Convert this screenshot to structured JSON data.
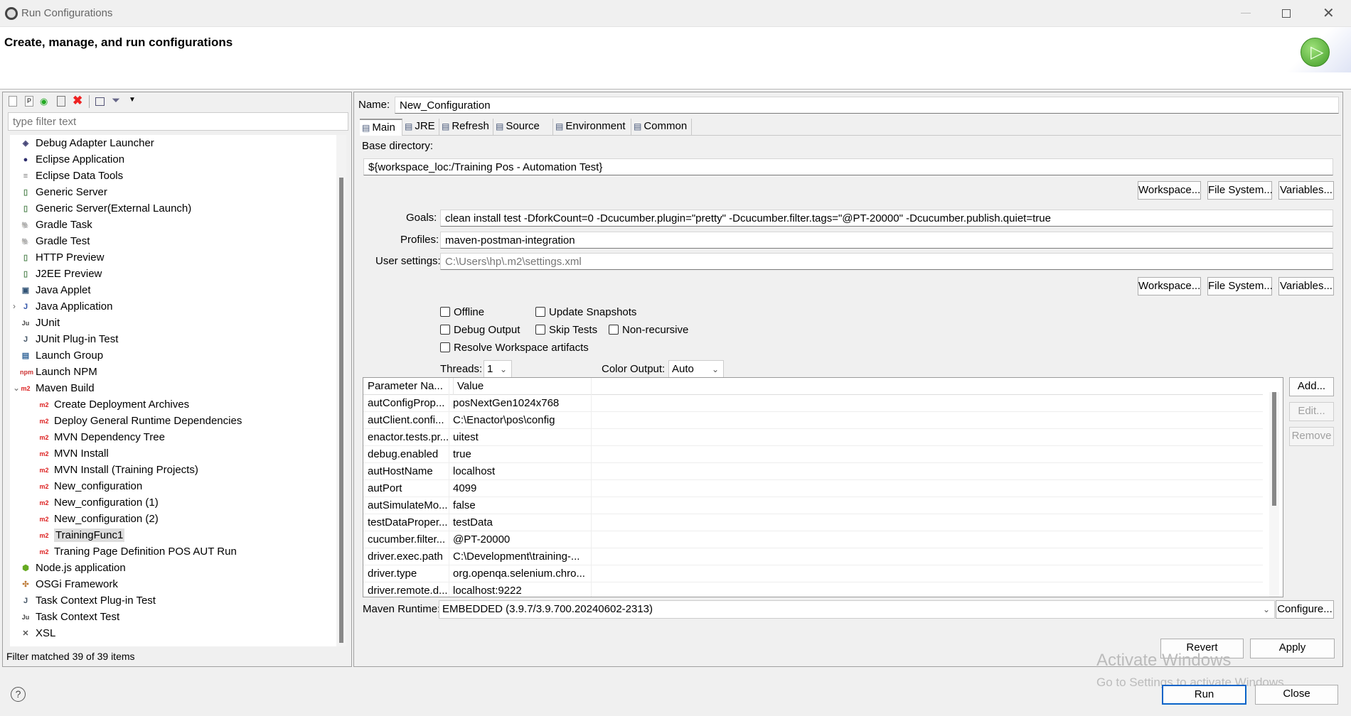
{
  "window": {
    "title": "Run Configurations"
  },
  "header": {
    "title": "Create, manage, and run configurations"
  },
  "left": {
    "filter_placeholder": "type filter text",
    "status": "Filter matched 39 of 39 items",
    "tree": [
      {
        "label": "Debug Adapter Launcher",
        "icon": "debug-adapter-icon",
        "level": 0
      },
      {
        "label": "Eclipse Application",
        "icon": "eclipse-icon",
        "level": 0
      },
      {
        "label": "Eclipse Data Tools",
        "icon": "database-icon",
        "level": 0
      },
      {
        "label": "Generic Server",
        "icon": "server-icon",
        "level": 0
      },
      {
        "label": "Generic Server(External Launch)",
        "icon": "server-icon",
        "level": 0
      },
      {
        "label": "Gradle Task",
        "icon": "gradle-icon",
        "level": 0
      },
      {
        "label": "Gradle Test",
        "icon": "gradle-icon",
        "level": 0
      },
      {
        "label": "HTTP Preview",
        "icon": "server-icon",
        "level": 0
      },
      {
        "label": "J2EE Preview",
        "icon": "server-icon",
        "level": 0
      },
      {
        "label": "Java Applet",
        "icon": "applet-icon",
        "level": 0
      },
      {
        "label": "Java Application",
        "icon": "java-app-icon",
        "level": 0,
        "expander": "›"
      },
      {
        "label": "JUnit",
        "icon": "junit-icon",
        "level": 0
      },
      {
        "label": "JUnit Plug-in Test",
        "icon": "junit-plugin-icon",
        "level": 0
      },
      {
        "label": "Launch Group",
        "icon": "launch-group-icon",
        "level": 0
      },
      {
        "label": "Launch NPM",
        "icon": "npm-icon",
        "level": 0
      },
      {
        "label": "Maven Build",
        "icon": "maven-icon",
        "level": 0,
        "expander": "⌄"
      },
      {
        "label": "Create Deployment Archives",
        "icon": "maven-icon",
        "level": 1
      },
      {
        "label": "Deploy General Runtime Dependencies",
        "icon": "maven-icon",
        "level": 1
      },
      {
        "label": "MVN Dependency Tree",
        "icon": "maven-icon",
        "level": 1
      },
      {
        "label": "MVN Install",
        "icon": "maven-icon",
        "level": 1
      },
      {
        "label": "MVN Install (Training Projects)",
        "icon": "maven-icon",
        "level": 1
      },
      {
        "label": "New_configuration",
        "icon": "maven-icon",
        "level": 1
      },
      {
        "label": "New_configuration (1)",
        "icon": "maven-icon",
        "level": 1
      },
      {
        "label": "New_configuration (2)",
        "icon": "maven-icon",
        "level": 1
      },
      {
        "label": "TrainingFunc1",
        "icon": "maven-icon",
        "level": 1,
        "selected": true
      },
      {
        "label": "Traning Page Definition POS AUT Run",
        "icon": "maven-icon",
        "level": 1
      },
      {
        "label": "Node.js application",
        "icon": "nodejs-icon",
        "level": 0
      },
      {
        "label": "OSGi Framework",
        "icon": "osgi-icon",
        "level": 0
      },
      {
        "label": "Task Context Plug-in Test",
        "icon": "junit-plugin-icon",
        "level": 0
      },
      {
        "label": "Task Context Test",
        "icon": "junit-icon",
        "level": 0
      },
      {
        "label": "XSL",
        "icon": "xsl-icon",
        "level": 0
      }
    ]
  },
  "config": {
    "name_label": "Name:",
    "name_value": "New_Configuration",
    "tabs": [
      "Main",
      "JRE",
      "Refresh",
      "Source",
      "Environment",
      "Common"
    ],
    "base_dir_label": "Base directory:",
    "base_dir_value": "${workspace_loc:/Training Pos - Automation Test}",
    "workspace_btn": "Workspace...",
    "filesystem_btn": "File System...",
    "variables_btn": "Variables...",
    "goals_label": "Goals:",
    "goals_value": "clean install test -DforkCount=0  -Dcucumber.plugin=\"pretty\"  -Dcucumber.filter.tags=\"@PT-20000\"   -Dcucumber.publish.quiet=true",
    "profiles_label": "Profiles:",
    "profiles_value": "maven-postman-integration",
    "user_settings_label": "User settings:",
    "user_settings_value": "C:\\Users\\hp\\.m2\\settings.xml",
    "checkboxes": {
      "offline": "Offline",
      "update_snapshots": "Update Snapshots",
      "debug_output": "Debug Output",
      "skip_tests": "Skip Tests",
      "non_recursive": "Non-recursive",
      "resolve_workspace": "Resolve Workspace artifacts"
    },
    "threads_label": "Threads:",
    "threads_value": "1",
    "color_output_label": "Color Output:",
    "color_output_value": "Auto",
    "params_headers": [
      "Parameter Na...",
      "Value"
    ],
    "params": [
      [
        "autConfigProp...",
        "posNextGen1024x768"
      ],
      [
        "autClient.confi...",
        "C:\\Enactor\\pos\\config"
      ],
      [
        "enactor.tests.pr...",
        "uitest"
      ],
      [
        "debug.enabled",
        "true"
      ],
      [
        "autHostName",
        "localhost"
      ],
      [
        "autPort",
        "4099"
      ],
      [
        "autSimulateMo...",
        "false"
      ],
      [
        "testDataProper...",
        "testData"
      ],
      [
        "cucumber.filter...",
        "@PT-20000"
      ],
      [
        "driver.exec.path",
        "C:\\Development\\training-..."
      ],
      [
        "driver.type",
        "org.openqa.selenium.chro..."
      ],
      [
        "driver.remote.d...",
        "localhost:9222"
      ]
    ],
    "add_btn": "Add...",
    "edit_btn": "Edit...",
    "remove_btn": "Remove",
    "runtime_label": "Maven Runtime:",
    "runtime_value": "EMBEDDED (3.9.7/3.9.700.20240602-2313)",
    "configure_btn": "Configure...",
    "revert_btn": "Revert",
    "apply_btn": "Apply"
  },
  "footer": {
    "run_btn": "Run",
    "close_btn": "Close"
  },
  "watermark": {
    "title": "Activate Windows",
    "subtitle": "Go to Settings to activate Windows."
  }
}
